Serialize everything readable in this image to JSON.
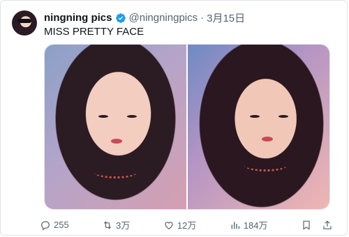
{
  "author": {
    "name": "ningning pics",
    "handle": "@ningningpics",
    "separator": "·",
    "date": "3月15日"
  },
  "tweet": {
    "text": "MISS PRETTY FACE"
  },
  "media": {
    "count": 2
  },
  "actions": {
    "replies": "255",
    "retweets": "3万",
    "likes": "12万",
    "views": "184万"
  },
  "icons": {
    "verified": "verified-badge-icon",
    "reply": "reply-icon",
    "retweet": "retweet-icon",
    "like": "heart-icon",
    "views": "views-icon",
    "bookmark": "bookmark-icon",
    "share": "share-icon",
    "more": "more-icon"
  },
  "colors": {
    "verified": "#1d9bf0",
    "muted": "#536471",
    "text": "#0f1419"
  }
}
